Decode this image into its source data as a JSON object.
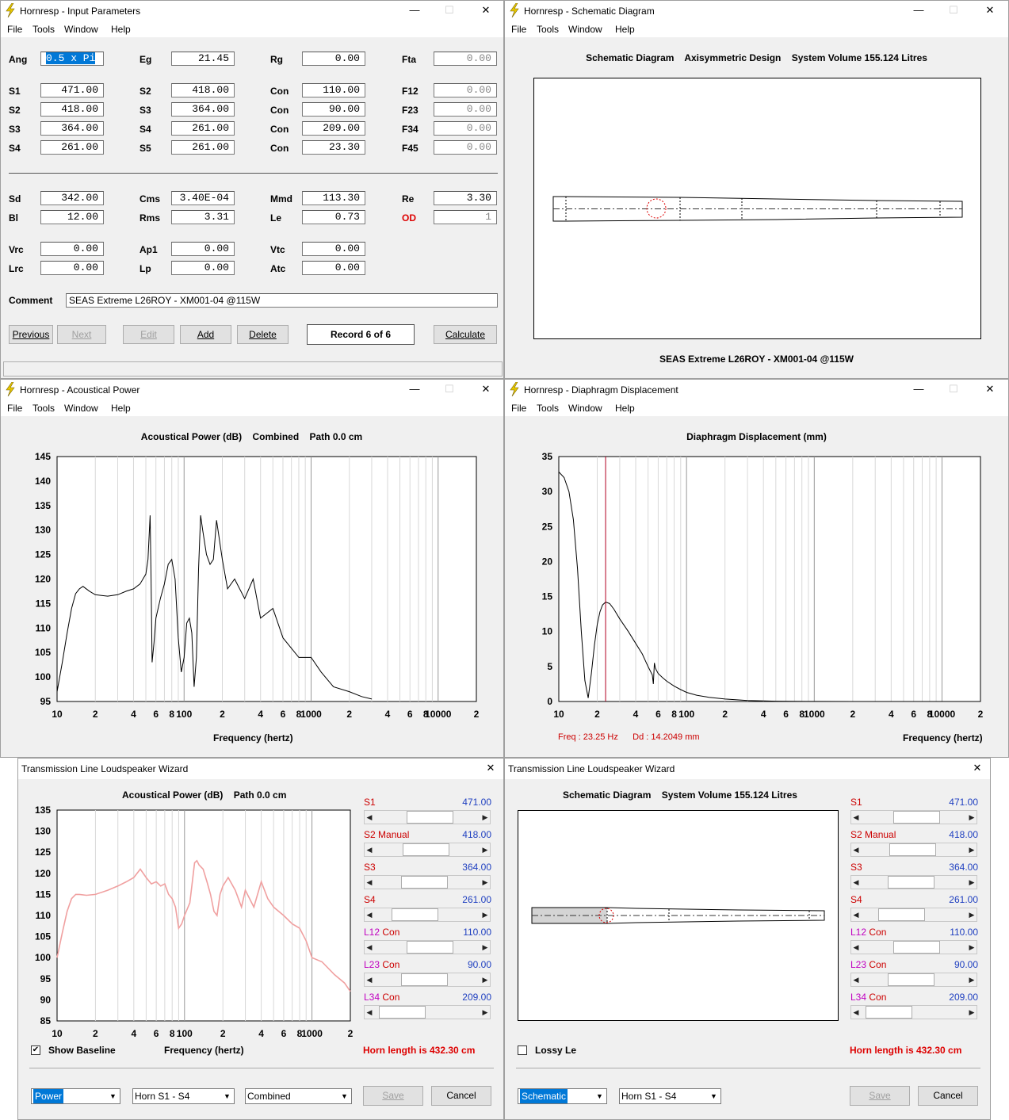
{
  "input": {
    "title": "Hornresp - Input Parameters",
    "menu": [
      "File",
      "Tools",
      "Window",
      "Help"
    ],
    "fields": [
      {
        "l": "Ang",
        "v": "0.5 x Pi"
      },
      {
        "l": "Eg",
        "v": "21.45"
      },
      {
        "l": "Rg",
        "v": "0.00"
      },
      {
        "l": "Fta",
        "v": "0.00"
      },
      {
        "l": "S1",
        "v": "471.00"
      },
      {
        "l": "S2",
        "v": "418.00"
      },
      {
        "l": "Con",
        "v": "110.00"
      },
      {
        "l": "F12",
        "v": "0.00"
      },
      {
        "l": "S2",
        "v": "418.00"
      },
      {
        "l": "S3",
        "v": "364.00"
      },
      {
        "l": "Con",
        "v": "90.00"
      },
      {
        "l": "F23",
        "v": "0.00"
      },
      {
        "l": "S3",
        "v": "364.00"
      },
      {
        "l": "S4",
        "v": "261.00"
      },
      {
        "l": "Con",
        "v": "209.00"
      },
      {
        "l": "F34",
        "v": "0.00"
      },
      {
        "l": "S4",
        "v": "261.00"
      },
      {
        "l": "S5",
        "v": "261.00"
      },
      {
        "l": "Con",
        "v": "23.30"
      },
      {
        "l": "F45",
        "v": "0.00"
      },
      {
        "l": "Sd",
        "v": "342.00"
      },
      {
        "l": "Cms",
        "v": "3.40E-04"
      },
      {
        "l": "Mmd",
        "v": "113.30"
      },
      {
        "l": "Re",
        "v": "3.30"
      },
      {
        "l": "Bl",
        "v": "12.00"
      },
      {
        "l": "Rms",
        "v": "3.31"
      },
      {
        "l": "Le",
        "v": "0.73"
      },
      {
        "l": "OD",
        "v": "1"
      },
      {
        "l": "Vrc",
        "v": "0.00"
      },
      {
        "l": "Ap1",
        "v": "0.00"
      },
      {
        "l": "Vtc",
        "v": "0.00"
      },
      {
        "l": "Lrc",
        "v": "0.00"
      },
      {
        "l": "Lp",
        "v": "0.00"
      },
      {
        "l": "Atc",
        "v": "0.00"
      }
    ],
    "comment_label": "Comment",
    "comment": "SEAS Extreme L26ROY - XM001-04 @115W",
    "buttons": [
      "Previous",
      "Next",
      "Edit",
      "Add",
      "Delete",
      "Calculate"
    ],
    "record": "Record 6 of 6"
  },
  "schem": {
    "title": "Hornresp - Schematic Diagram",
    "menu": [
      "File",
      "Tools",
      "Window",
      "Help"
    ],
    "heading": "Schematic Diagram    Axisymmetric Design    System Volume 155.124 Litres",
    "footer": "SEAS Extreme L26ROY - XM001-04 @115W"
  },
  "acp": {
    "title": "Hornresp - Acoustical Power",
    "menu": [
      "File",
      "Tools",
      "Window",
      "Help"
    ],
    "heading": "Acoustical Power (dB)    Combined    Path 0.0 cm",
    "xlabel": "Frequency (hertz)"
  },
  "disp": {
    "title": "Hornresp - Diaphragm Displacement",
    "menu": [
      "File",
      "Tools",
      "Window",
      "Help"
    ],
    "heading": "Diaphragm Displacement (mm)",
    "xlabel": "Frequency (hertz)",
    "cursor": "Freq : 23.25 Hz      Dd : 14.2049 mm"
  },
  "wiz1": {
    "title": "Transmission Line Loudspeaker Wizard",
    "heading": "Acoustical Power (dB)    Path 0.0 cm",
    "xlabel": "Frequency (hertz)",
    "check": "Show Baseline",
    "horn": "Horn length is 432.30 cm",
    "dd": [
      "Power",
      "Horn S1 - S4",
      "Combined"
    ],
    "save": "Save",
    "cancel": "Cancel"
  },
  "wiz2": {
    "title": "Transmission Line Loudspeaker Wizard",
    "heading": "Schematic Diagram    System Volume 155.124 Litres",
    "check": "Lossy Le",
    "horn": "Horn length is 432.30 cm",
    "dd": [
      "Schematic",
      "Horn S1 - S4"
    ],
    "save": "Save",
    "cancel": "Cancel"
  },
  "sliders": [
    {
      "a": "S1",
      "b": "",
      "v": "471.00",
      "pos": 0.55
    },
    {
      "a": "S2",
      "b": "Manual",
      "v": "418.00",
      "pos": 0.48
    },
    {
      "a": "S3",
      "b": "",
      "v": "364.00",
      "pos": 0.45
    },
    {
      "a": "S4",
      "b": "",
      "v": "261.00",
      "pos": 0.28
    },
    {
      "a": "L12",
      "b": "Con",
      "v": "110.00",
      "pos": 0.55
    },
    {
      "a": "L23",
      "b": "Con",
      "v": "90.00",
      "pos": 0.45
    },
    {
      "a": "L34",
      "b": "Con",
      "v": "209.00",
      "pos": 0.06
    }
  ],
  "chart_data": [
    {
      "type": "line",
      "title": "Acoustical Power (dB)    Combined    Path 0.0 cm",
      "xlabel": "Frequency (hertz)",
      "ylabel": "",
      "xscale": "log",
      "xlim": [
        10,
        20000
      ],
      "ylim": [
        95,
        145
      ],
      "yticks": [
        "145",
        "140",
        "135",
        "130",
        "125",
        "120",
        "115",
        "110",
        "105",
        "100",
        "95"
      ],
      "xticks": [
        "10",
        "2",
        "4",
        "6",
        "8",
        "100",
        "2",
        "4",
        "6",
        "8",
        "1000",
        "2",
        "4",
        "6",
        "8",
        "10000",
        "2"
      ],
      "series": [
        {
          "x": [
            10,
            11,
            12,
            13,
            14,
            15,
            16,
            18,
            20,
            25,
            30,
            35,
            40,
            45,
            50,
            52,
            54,
            55,
            56,
            58,
            60,
            65,
            70,
            75,
            80,
            85,
            90,
            95,
            100,
            105,
            110,
            115,
            120,
            125,
            130,
            135,
            140,
            150,
            160,
            170,
            180,
            200,
            220,
            250,
            300,
            350,
            400,
            500,
            600,
            800,
            1000,
            1200,
            1500,
            2000,
            2500,
            3000
          ],
          "y": [
            97,
            103,
            109,
            114,
            117,
            118,
            118.5,
            117.5,
            116.8,
            116.5,
            116.8,
            117.5,
            118,
            119,
            121,
            124,
            133,
            120,
            103,
            107,
            112,
            116,
            119,
            123,
            124,
            120,
            108,
            101,
            104,
            111,
            112,
            109,
            98,
            104,
            122,
            133,
            130,
            125,
            123,
            124,
            132,
            124,
            118,
            120,
            116,
            120,
            112,
            114,
            108,
            104,
            104,
            101,
            98,
            97,
            96,
            95.5
          ]
        }
      ]
    },
    {
      "type": "line",
      "title": "Diaphragm Displacement (mm)",
      "xlabel": "Frequency (hertz)",
      "ylabel": "",
      "xscale": "log",
      "xlim": [
        10,
        20000
      ],
      "ylim": [
        0,
        35
      ],
      "yticks": [
        "35",
        "30",
        "25",
        "20",
        "15",
        "10",
        "5",
        "0"
      ],
      "xticks": [
        "10",
        "2",
        "4",
        "6",
        "8",
        "100",
        "2",
        "4",
        "6",
        "8",
        "1000",
        "2",
        "4",
        "6",
        "8",
        "10000",
        "2"
      ],
      "series": [
        {
          "x": [
            10,
            11,
            12,
            13,
            14,
            15,
            16,
            17,
            18,
            19,
            20,
            21,
            22,
            23.25,
            25,
            27,
            30,
            35,
            40,
            45,
            50,
            54,
            55,
            56,
            57,
            58,
            60,
            65,
            70,
            80,
            90,
            100,
            120,
            150,
            200,
            300,
            500,
            1000,
            2000,
            5000,
            20000
          ],
          "y": [
            32.8,
            32,
            30,
            26,
            19,
            10,
            3,
            0.5,
            4,
            8,
            11,
            12.8,
            13.8,
            14.2,
            14,
            13.2,
            11.8,
            10,
            8.3,
            6.8,
            5,
            3.8,
            2.5,
            5.5,
            4.8,
            4.5,
            4,
            3.4,
            2.9,
            2.2,
            1.7,
            1.3,
            0.9,
            0.6,
            0.35,
            0.15,
            0.05,
            0.01,
            0,
            0,
            0
          ]
        }
      ]
    },
    {
      "type": "line",
      "title": "Acoustical Power (dB)    Path 0.0 cm",
      "xlabel": "Frequency (hertz)",
      "ylabel": "",
      "xscale": "log",
      "xlim": [
        10,
        2000
      ],
      "ylim": [
        85,
        135
      ],
      "yticks": [
        "135",
        "130",
        "125",
        "120",
        "115",
        "110",
        "105",
        "100",
        "95",
        "90",
        "85"
      ],
      "xticks": [
        "10",
        "2",
        "4",
        "6",
        "8",
        "100",
        "2",
        "4",
        "6",
        "8",
        "1000",
        "2"
      ],
      "series": [
        {
          "x": [
            10,
            11,
            12,
            13,
            14,
            15,
            17,
            20,
            25,
            30,
            35,
            40,
            45,
            50,
            55,
            60,
            65,
            70,
            75,
            80,
            85,
            90,
            95,
            100,
            110,
            120,
            125,
            130,
            140,
            150,
            160,
            170,
            180,
            190,
            200,
            220,
            250,
            280,
            300,
            350,
            400,
            450,
            500,
            600,
            700,
            800,
            900,
            1000,
            1200,
            1500,
            1800,
            2000
          ],
          "y": [
            100,
            106,
            111,
            114,
            115,
            115,
            114.8,
            115,
            116,
            117,
            118,
            119,
            121,
            119,
            117.5,
            118,
            117,
            117.5,
            115,
            114,
            112,
            107,
            108,
            110,
            113,
            122.5,
            123,
            122,
            121,
            118,
            115,
            111,
            110,
            115,
            117,
            119,
            116,
            112,
            116,
            112,
            118,
            114,
            112,
            110,
            108,
            107,
            104,
            100,
            99,
            96,
            94,
            92
          ]
        }
      ]
    }
  ]
}
